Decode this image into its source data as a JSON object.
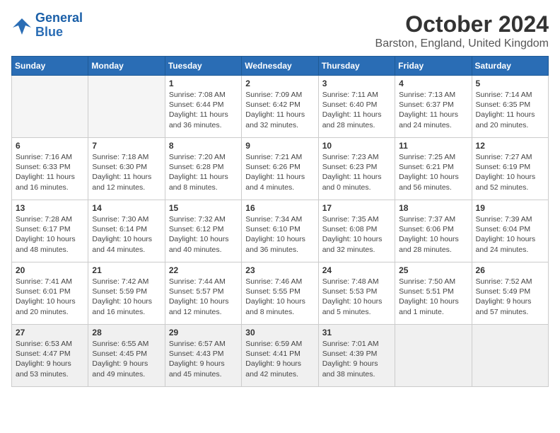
{
  "logo": {
    "line1": "General",
    "line2": "Blue"
  },
  "title": "October 2024",
  "subtitle": "Barston, England, United Kingdom",
  "days_of_week": [
    "Sunday",
    "Monday",
    "Tuesday",
    "Wednesday",
    "Thursday",
    "Friday",
    "Saturday"
  ],
  "weeks": [
    [
      {
        "day": "",
        "info": ""
      },
      {
        "day": "",
        "info": ""
      },
      {
        "day": "1",
        "info": "Sunrise: 7:08 AM\nSunset: 6:44 PM\nDaylight: 11 hours and 36 minutes."
      },
      {
        "day": "2",
        "info": "Sunrise: 7:09 AM\nSunset: 6:42 PM\nDaylight: 11 hours and 32 minutes."
      },
      {
        "day": "3",
        "info": "Sunrise: 7:11 AM\nSunset: 6:40 PM\nDaylight: 11 hours and 28 minutes."
      },
      {
        "day": "4",
        "info": "Sunrise: 7:13 AM\nSunset: 6:37 PM\nDaylight: 11 hours and 24 minutes."
      },
      {
        "day": "5",
        "info": "Sunrise: 7:14 AM\nSunset: 6:35 PM\nDaylight: 11 hours and 20 minutes."
      }
    ],
    [
      {
        "day": "6",
        "info": "Sunrise: 7:16 AM\nSunset: 6:33 PM\nDaylight: 11 hours and 16 minutes."
      },
      {
        "day": "7",
        "info": "Sunrise: 7:18 AM\nSunset: 6:30 PM\nDaylight: 11 hours and 12 minutes."
      },
      {
        "day": "8",
        "info": "Sunrise: 7:20 AM\nSunset: 6:28 PM\nDaylight: 11 hours and 8 minutes."
      },
      {
        "day": "9",
        "info": "Sunrise: 7:21 AM\nSunset: 6:26 PM\nDaylight: 11 hours and 4 minutes."
      },
      {
        "day": "10",
        "info": "Sunrise: 7:23 AM\nSunset: 6:23 PM\nDaylight: 11 hours and 0 minutes."
      },
      {
        "day": "11",
        "info": "Sunrise: 7:25 AM\nSunset: 6:21 PM\nDaylight: 10 hours and 56 minutes."
      },
      {
        "day": "12",
        "info": "Sunrise: 7:27 AM\nSunset: 6:19 PM\nDaylight: 10 hours and 52 minutes."
      }
    ],
    [
      {
        "day": "13",
        "info": "Sunrise: 7:28 AM\nSunset: 6:17 PM\nDaylight: 10 hours and 48 minutes."
      },
      {
        "day": "14",
        "info": "Sunrise: 7:30 AM\nSunset: 6:14 PM\nDaylight: 10 hours and 44 minutes."
      },
      {
        "day": "15",
        "info": "Sunrise: 7:32 AM\nSunset: 6:12 PM\nDaylight: 10 hours and 40 minutes."
      },
      {
        "day": "16",
        "info": "Sunrise: 7:34 AM\nSunset: 6:10 PM\nDaylight: 10 hours and 36 minutes."
      },
      {
        "day": "17",
        "info": "Sunrise: 7:35 AM\nSunset: 6:08 PM\nDaylight: 10 hours and 32 minutes."
      },
      {
        "day": "18",
        "info": "Sunrise: 7:37 AM\nSunset: 6:06 PM\nDaylight: 10 hours and 28 minutes."
      },
      {
        "day": "19",
        "info": "Sunrise: 7:39 AM\nSunset: 6:04 PM\nDaylight: 10 hours and 24 minutes."
      }
    ],
    [
      {
        "day": "20",
        "info": "Sunrise: 7:41 AM\nSunset: 6:01 PM\nDaylight: 10 hours and 20 minutes."
      },
      {
        "day": "21",
        "info": "Sunrise: 7:42 AM\nSunset: 5:59 PM\nDaylight: 10 hours and 16 minutes."
      },
      {
        "day": "22",
        "info": "Sunrise: 7:44 AM\nSunset: 5:57 PM\nDaylight: 10 hours and 12 minutes."
      },
      {
        "day": "23",
        "info": "Sunrise: 7:46 AM\nSunset: 5:55 PM\nDaylight: 10 hours and 8 minutes."
      },
      {
        "day": "24",
        "info": "Sunrise: 7:48 AM\nSunset: 5:53 PM\nDaylight: 10 hours and 5 minutes."
      },
      {
        "day": "25",
        "info": "Sunrise: 7:50 AM\nSunset: 5:51 PM\nDaylight: 10 hours and 1 minute."
      },
      {
        "day": "26",
        "info": "Sunrise: 7:52 AM\nSunset: 5:49 PM\nDaylight: 9 hours and 57 minutes."
      }
    ],
    [
      {
        "day": "27",
        "info": "Sunrise: 6:53 AM\nSunset: 4:47 PM\nDaylight: 9 hours and 53 minutes."
      },
      {
        "day": "28",
        "info": "Sunrise: 6:55 AM\nSunset: 4:45 PM\nDaylight: 9 hours and 49 minutes."
      },
      {
        "day": "29",
        "info": "Sunrise: 6:57 AM\nSunset: 4:43 PM\nDaylight: 9 hours and 45 minutes."
      },
      {
        "day": "30",
        "info": "Sunrise: 6:59 AM\nSunset: 4:41 PM\nDaylight: 9 hours and 42 minutes."
      },
      {
        "day": "31",
        "info": "Sunrise: 7:01 AM\nSunset: 4:39 PM\nDaylight: 9 hours and 38 minutes."
      },
      {
        "day": "",
        "info": ""
      },
      {
        "day": "",
        "info": ""
      }
    ]
  ]
}
